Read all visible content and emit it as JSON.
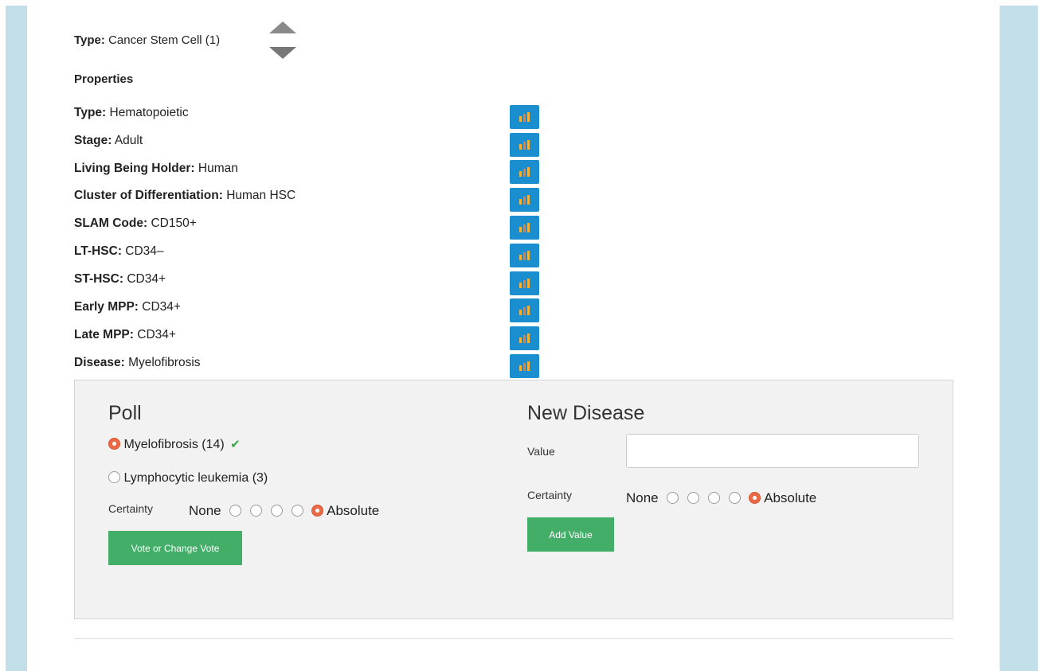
{
  "header": {
    "type_label": "Type:",
    "type_value": "Cancer Stem Cell (1)",
    "properties_heading": "Properties"
  },
  "properties": [
    {
      "label": "Type:",
      "value": "Hematopoietic"
    },
    {
      "label": "Stage:",
      "value": "Adult"
    },
    {
      "label": "Living Being Holder:",
      "value": "Human"
    },
    {
      "label": "Cluster of Differentiation:",
      "value": "Human HSC"
    },
    {
      "label": "SLAM Code:",
      "value": "CD150+"
    },
    {
      "label": "LT-HSC:",
      "value": "CD34–"
    },
    {
      "label": "ST-HSC:",
      "value": "CD34+"
    },
    {
      "label": "Early MPP:",
      "value": "CD34+"
    },
    {
      "label": "Late MPP:",
      "value": "CD34+"
    },
    {
      "label": "Disease:",
      "value": "Myelofibrosis"
    }
  ],
  "poll": {
    "title": "Poll",
    "options": [
      {
        "label": "Myelofibrosis (14)",
        "selected": true
      },
      {
        "label": "Lymphocytic leukemia (3)",
        "selected": false
      }
    ],
    "certainty_label": "Certainty",
    "certainty_min": "None",
    "certainty_max": "Absolute",
    "certainty_selected": 5,
    "vote_button": "Vote or Change Vote"
  },
  "new_disease": {
    "title": "New Disease",
    "value_label": "Value",
    "value": "",
    "certainty_label": "Certainty",
    "certainty_min": "None",
    "certainty_max": "Absolute",
    "certainty_selected": 5,
    "add_button": "Add Value"
  },
  "colors": {
    "sidebar": "#c2dfe9",
    "chart_button": "#1a8ecf",
    "green_button": "#43ae68",
    "radio_selected": "#e86a47"
  }
}
